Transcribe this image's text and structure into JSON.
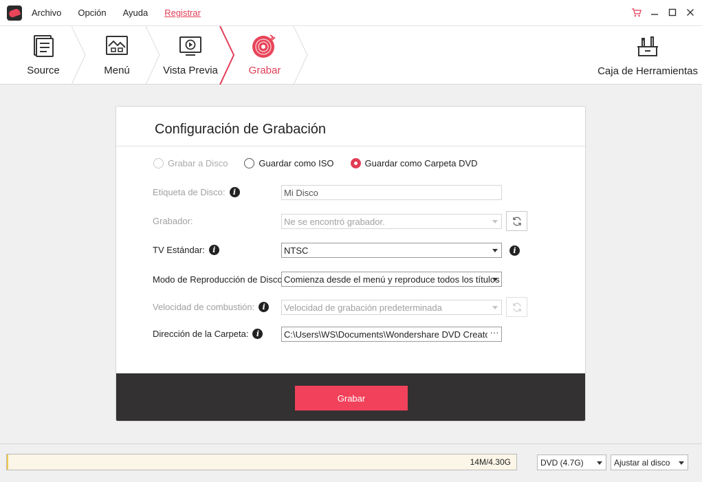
{
  "menu": {
    "items": [
      "Archivo",
      "Opción",
      "Ayuda"
    ],
    "register": "Registrar"
  },
  "window": {
    "icons": [
      "cart-icon",
      "minimize-icon",
      "maximize-icon",
      "close-icon"
    ]
  },
  "steps": [
    {
      "label": "Source",
      "icon": "document-icon",
      "active": false
    },
    {
      "label": "Menú",
      "icon": "image-icon",
      "active": false
    },
    {
      "label": "Vista Previa",
      "icon": "play-monitor-icon",
      "active": false
    },
    {
      "label": "Grabar",
      "icon": "disc-icon",
      "active": true
    }
  ],
  "toolbox": {
    "label": "Caja de Herramientas",
    "icon": "toolbox-icon"
  },
  "panel": {
    "title": "Configuración de Grabación",
    "options": [
      {
        "label": "Grabar a Disco",
        "state": "disabled"
      },
      {
        "label": "Guardar como ISO",
        "state": "unchecked"
      },
      {
        "label": "Guardar como Carpeta DVD",
        "state": "checked"
      }
    ],
    "disc_label": {
      "label": "Etiqueta de Disco:",
      "value": "Mi Disco"
    },
    "burner": {
      "label": "Grabador:",
      "value": "Ne se encontró grabador."
    },
    "tv_standard": {
      "label": "TV Estándar:",
      "value": "NTSC"
    },
    "playback_mode": {
      "label": "Modo de Reproducción de Disco:",
      "value": "Comienza desde el menú y reproduce todos los títulos"
    },
    "burn_speed": {
      "label": "Velocidad de combustión:",
      "value": "Velocidad de grabación predeterminada"
    },
    "folder_path": {
      "label": "Dirección de la Carpeta:",
      "value": "C:\\Users\\WS\\Documents\\Wondershare DVD Creator\\Output",
      "browse": "···"
    },
    "burn_button": "Grabar"
  },
  "status": {
    "capacity_text": "14M/4.30G",
    "capacity_fraction": 0.003,
    "disc_type": "DVD (4.7G)",
    "fit_mode": "Ajustar al disco"
  },
  "colors": {
    "accent": "#e23c55",
    "burn_button": "#f2415a",
    "footer_dark": "#333131"
  }
}
